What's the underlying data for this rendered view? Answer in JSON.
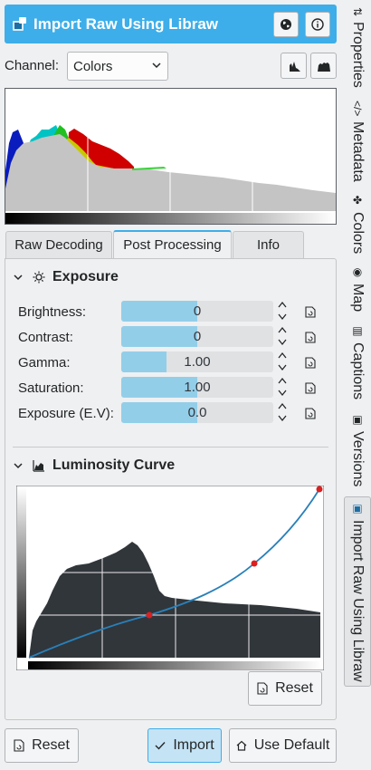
{
  "header": {
    "title": "Import Raw Using Libraw",
    "icon": "camera-raw-icon",
    "buttons": [
      {
        "name": "website-button",
        "icon": "globe-icon"
      },
      {
        "name": "about-button",
        "icon": "info-icon"
      }
    ]
  },
  "channel": {
    "label": "Channel:",
    "selected": "Colors",
    "scale_buttons": [
      "linear-scale-icon",
      "log-scale-icon"
    ]
  },
  "tabs": [
    {
      "label": "Raw Decoding",
      "active": false
    },
    {
      "label": "Post Processing",
      "active": true
    },
    {
      "label": "Info",
      "active": false
    }
  ],
  "exposure": {
    "title": "Exposure",
    "rows": [
      {
        "label": "Brightness:",
        "value": "0",
        "fill": 0.5
      },
      {
        "label": "Contrast:",
        "value": "0",
        "fill": 0.5
      },
      {
        "label": "Gamma:",
        "value": "1.00",
        "fill": 0.3
      },
      {
        "label": "Saturation:",
        "value": "1.00",
        "fill": 0.5
      },
      {
        "label": "Exposure (E.V):",
        "value": "0.0",
        "fill": 0.5
      }
    ]
  },
  "curve": {
    "title": "Luminosity Curve",
    "reset_label": "Reset"
  },
  "footer": {
    "reset_label": "Reset",
    "import_label": "Import",
    "default_label": "Use Default"
  },
  "sidebar_tabs": [
    {
      "label": "Properties",
      "icon": "properties-icon",
      "active": false
    },
    {
      "label": "Metadata",
      "icon": "code-icon",
      "active": false
    },
    {
      "label": "Colors",
      "icon": "colors-icon",
      "active": false
    },
    {
      "label": "Map",
      "icon": "globe-icon",
      "active": false
    },
    {
      "label": "Captions",
      "icon": "captions-icon",
      "active": false
    },
    {
      "label": "Versions",
      "icon": "versions-icon",
      "active": false
    },
    {
      "label": "Import Raw Using Libraw",
      "icon": "camera-raw-icon",
      "active": true
    }
  ],
  "colors": {
    "accent": "#3daee9",
    "slider_fill": "#93cee9",
    "curve_line": "#2980b9",
    "curve_point": "#da2020"
  }
}
